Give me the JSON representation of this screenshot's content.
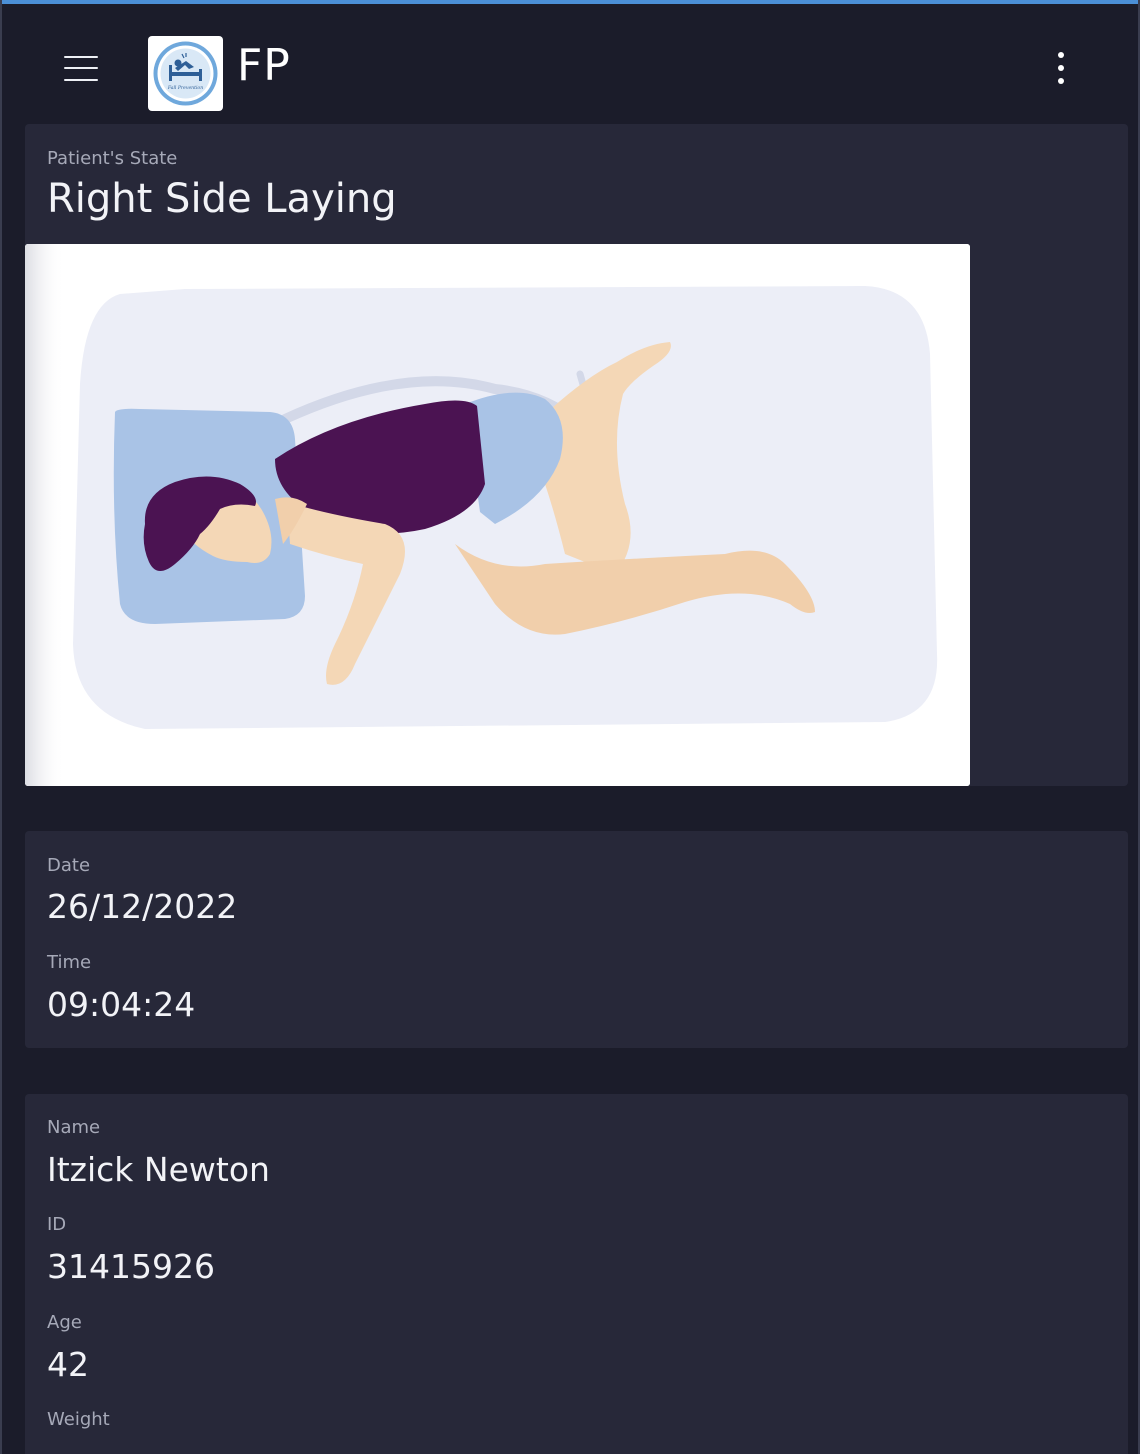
{
  "app": {
    "title": "FP",
    "logo_text": "Fall Prevention",
    "menu_icon": "hamburger-menu-icon",
    "overflow_icon": "more-vertical-icon"
  },
  "patient_state": {
    "label": "Patient's State",
    "value": "Right Side Laying",
    "illustration": "person-lying-on-right-side-illustration"
  },
  "timestamp": {
    "date_label": "Date",
    "date_value": "26/12/2022",
    "time_label": "Time",
    "time_value": "09:04:24"
  },
  "patient": {
    "name_label": "Name",
    "name_value": "Itzick Newton",
    "id_label": "ID",
    "id_value": "31415926",
    "age_label": "Age",
    "age_value": "42",
    "weight_label": "Weight"
  },
  "colors": {
    "accent": "#4b8fd6",
    "background": "#1b1c2a",
    "card": "#272839",
    "label": "#a6a9b8"
  }
}
